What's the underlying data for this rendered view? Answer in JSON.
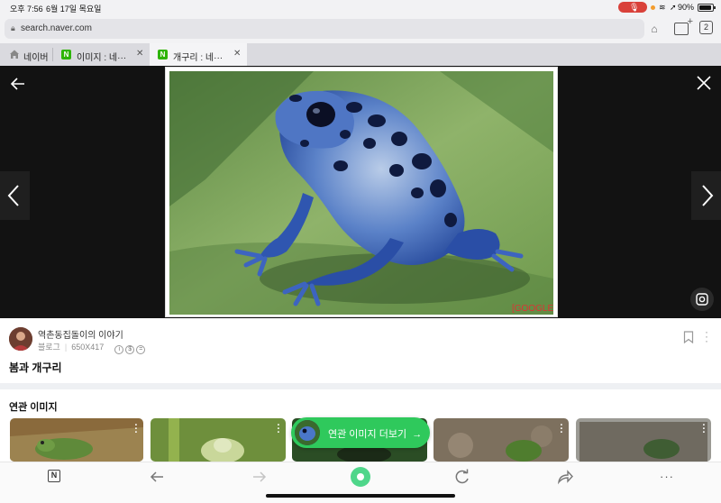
{
  "status_bar": {
    "time": "오후 7:56",
    "date": "6월 17일 목요일",
    "battery": "90%",
    "mic_color": "#d9413a"
  },
  "address_bar": {
    "url": "search.naver.com",
    "tab_count": "2"
  },
  "tabs": [
    {
      "label": "네이버",
      "icon": "home-icon"
    },
    {
      "label": "이미지 : 네···",
      "icon": "naver-n-icon"
    },
    {
      "label": "개구리 : 네···",
      "icon": "naver-n-icon",
      "active": true
    }
  ],
  "viewer": {
    "watermark": "[GOOGLE]"
  },
  "info": {
    "blog_name": "역촌동집돌이의 이야기",
    "source_type": "블로그",
    "dimensions": "650X417",
    "caption": "봄과 개구리"
  },
  "related": {
    "title": "연관 이미지",
    "more_label": "연관 이미지 더보기",
    "more_arrow": "→",
    "accent_color": "#2fc95c"
  },
  "toolbar": {
    "naver_label": "N",
    "more_label": "···"
  }
}
